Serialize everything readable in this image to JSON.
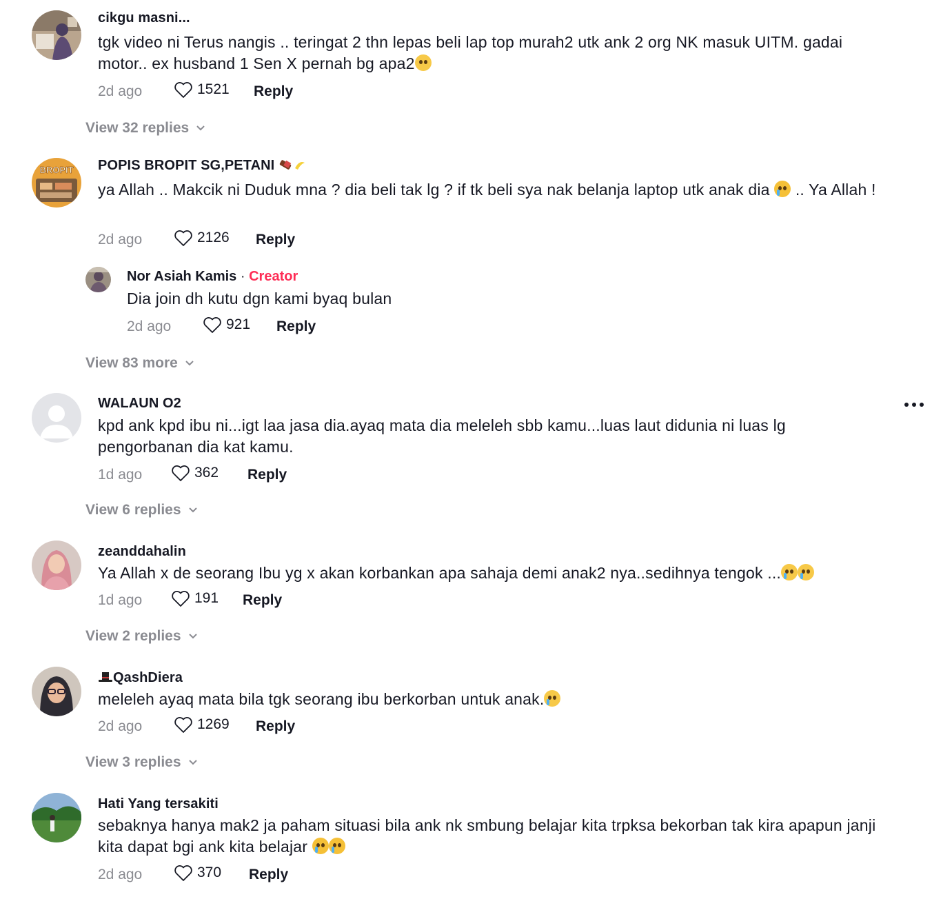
{
  "comments": [
    {
      "username": "cikgu masni...",
      "text": "tgk video ni Terus nangis .. teringat 2 thn lepas beli lap top murah2 utk ank 2 org NK masuk UITM. gadai motor.. ex husband 1 Sen X pernah bg apa2",
      "emoji": "pleading-face-emoji",
      "time": "2d ago",
      "likes": "1521",
      "reply_label": "Reply",
      "view_more": "View 32 replies"
    },
    {
      "username": "POPIS BROPIT SG,PETANI",
      "username_emoji": "chocolate-banana-emoji",
      "text": "ya Allah .. Makcik ni Duduk mna ? dia beli tak lg ? if tk beli sya nak belanja laptop utk anak dia",
      "text_tail": " .. Ya Allah !",
      "emoji": "crying-face-emoji",
      "time": "2d ago",
      "likes": "2126",
      "reply_label": "Reply",
      "reply": {
        "username": "Nor Asiah Kamis",
        "separator": " · ",
        "badge": "Creator",
        "text": "Dia join dh kutu dgn kami byaq bulan",
        "time": "2d ago",
        "likes": "921",
        "reply_label": "Reply"
      },
      "view_more": "View 83 more"
    },
    {
      "username": "WALAUN O2",
      "text": "kpd ank kpd ibu ni...igt laa jasa dia.ayaq mata dia meleleh sbb kamu...luas laut didunia ni luas lg pengorbanan dia kat kamu.",
      "time": "1d ago",
      "likes": "362",
      "reply_label": "Reply",
      "view_more": "View 6 replies"
    },
    {
      "username": "zeanddahalin",
      "text": "Ya Allah x de seorang Ibu yg x akan korbankan apa sahaja demi anak2 nya..sedihnya tengok ...",
      "emoji": "loudly-crying-face-emoji",
      "time": "1d ago",
      "likes": "191",
      "reply_label": "Reply",
      "view_more": "View 2 replies"
    },
    {
      "username": "QashDiera",
      "username_emoji": "top-hat-emoji",
      "text": "meleleh ayaq mata bila tgk seorang ibu berkorban untuk anak.",
      "emoji": "loudly-crying-face-emoji",
      "time": "2d ago",
      "likes": "1269",
      "reply_label": "Reply",
      "view_more": "View 3 replies"
    },
    {
      "username": "Hati Yang tersakiti",
      "text": "sebaknya hanya mak2 ja paham situasi bila ank nk smbung belajar kita trpksa bekorban tak kira apapun janji kita dapat bgi ank kita belajar",
      "emoji": "crying-face-emoji",
      "time": "2d ago",
      "likes": "370",
      "reply_label": "Reply"
    }
  ],
  "colors": {
    "text": "#161823",
    "muted": "#8a8b91",
    "creator": "#fe2c55"
  }
}
